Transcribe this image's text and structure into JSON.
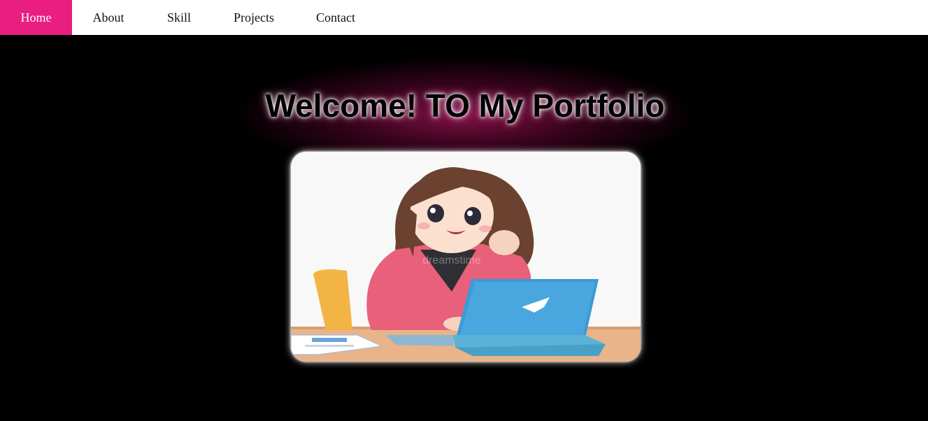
{
  "nav": {
    "items": [
      {
        "label": "Home",
        "active": true
      },
      {
        "label": "About",
        "active": false
      },
      {
        "label": "Skill",
        "active": false
      },
      {
        "label": "Projects",
        "active": false
      },
      {
        "label": "Contact",
        "active": false
      }
    ]
  },
  "hero": {
    "title": "Welcome! TO My Portfolio",
    "image_watermark": "dreamstime"
  },
  "colors": {
    "accent": "#e91e80",
    "background": "#000000",
    "nav_background": "#ffffff"
  }
}
